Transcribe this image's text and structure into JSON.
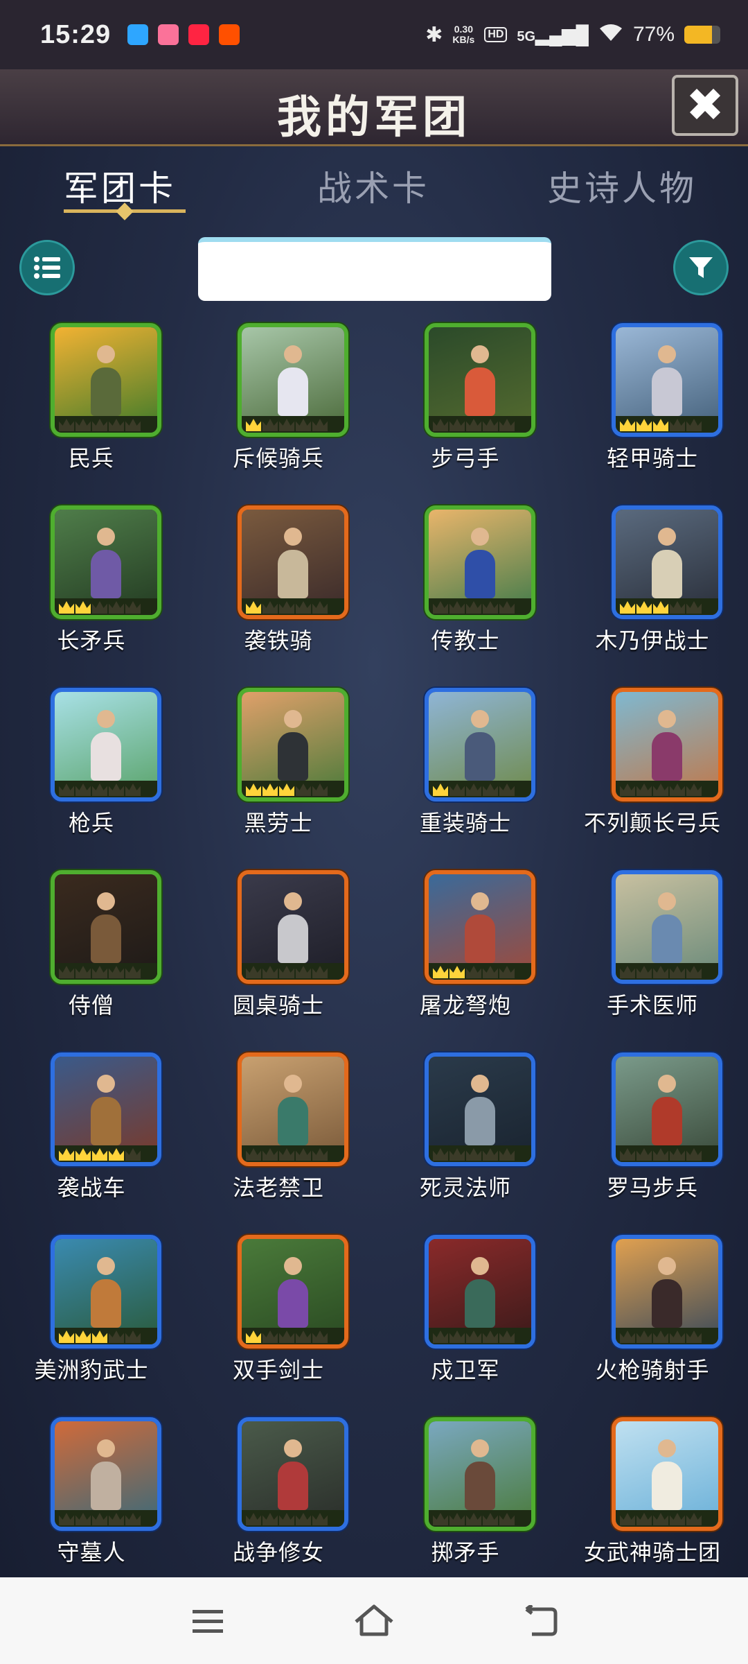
{
  "status_bar": {
    "time": "15:29",
    "net_speed": "0.30",
    "net_unit": "KB/s",
    "hd_badge": "HD",
    "signal_label": "5G",
    "battery_percent": "77%",
    "battery_level": 0.77,
    "notification_icons": [
      "telegram-icon",
      "bilibili-icon",
      "xiaohongshu-icon",
      "taobao-icon"
    ],
    "notification_colors": [
      "#2ea6ff",
      "#fb7299",
      "#ff2442",
      "#ff5000"
    ]
  },
  "header": {
    "title": "我的军团",
    "close_icon": "close-icon"
  },
  "tabs": [
    {
      "label": "军团卡",
      "active": true
    },
    {
      "label": "战术卡",
      "active": false
    },
    {
      "label": "史诗人物",
      "active": false
    }
  ],
  "toolbar": {
    "list_icon": "list-icon",
    "filter_icon": "filter-icon",
    "search_value": ""
  },
  "units": [
    {
      "name": "民兵",
      "rarity": "green",
      "stars": 0,
      "bg": [
        "#f2b233",
        "#3d7a2a"
      ],
      "tone": "#5a6a3a"
    },
    {
      "name": "斥候骑兵",
      "rarity": "green",
      "stars": 1,
      "bg": [
        "#a7c6a8",
        "#4b6a3a"
      ],
      "tone": "#e6e6f0"
    },
    {
      "name": "步弓手",
      "rarity": "green",
      "stars": 0,
      "bg": [
        "#2b4a2a",
        "#556b2f"
      ],
      "tone": "#d95a3a"
    },
    {
      "name": "轻甲骑士",
      "rarity": "blue",
      "stars": 3,
      "bg": [
        "#9ab7d6",
        "#44607a"
      ],
      "tone": "#c8c8d4"
    },
    {
      "name": "长矛兵",
      "rarity": "green",
      "stars": 2,
      "bg": [
        "#4f7d4a",
        "#233b22"
      ],
      "tone": "#6f5aa6"
    },
    {
      "name": "袭铁骑",
      "rarity": "orange",
      "stars": 1,
      "bg": [
        "#7a5a3e",
        "#3a2a2a"
      ],
      "tone": "#c8b89a"
    },
    {
      "name": "传教士",
      "rarity": "green",
      "stars": 0,
      "bg": [
        "#e9b56b",
        "#3f7a4a"
      ],
      "tone": "#2f4fa8"
    },
    {
      "name": "木乃伊战士",
      "rarity": "blue",
      "stars": 3,
      "bg": [
        "#5a6a7e",
        "#2a2f3a"
      ],
      "tone": "#d8cfb6"
    },
    {
      "name": "枪兵",
      "rarity": "blue",
      "stars": 0,
      "bg": [
        "#a8e0e6",
        "#5aa36a"
      ],
      "tone": "#e8e0e0"
    },
    {
      "name": "黑劳士",
      "rarity": "green",
      "stars": 3,
      "bg": [
        "#e0a06a",
        "#4a7a3a"
      ],
      "tone": "#2e3236"
    },
    {
      "name": "重装骑士",
      "rarity": "blue",
      "stars": 1,
      "bg": [
        "#8fb5d6",
        "#6f8a4a"
      ],
      "tone": "#4a5a7a"
    },
    {
      "name": "不列颠长弓兵",
      "rarity": "orange",
      "stars": 0,
      "bg": [
        "#7fb8d0",
        "#c0784a"
      ],
      "tone": "#8a3a6a"
    },
    {
      "name": "侍僧",
      "rarity": "green",
      "stars": 0,
      "bg": [
        "#3a2a1e",
        "#1e1a18"
      ],
      "tone": "#7a5a3a"
    },
    {
      "name": "圆桌骑士",
      "rarity": "orange",
      "stars": 0,
      "bg": [
        "#3a3a4a",
        "#1e1e28"
      ],
      "tone": "#c8c8cc"
    },
    {
      "name": "屠龙弩炮",
      "rarity": "orange",
      "stars": 2,
      "bg": [
        "#3a6a9a",
        "#a04a3a"
      ],
      "tone": "#b04a3a"
    },
    {
      "name": "手术医师",
      "rarity": "blue",
      "stars": 0,
      "bg": [
        "#c8c0a0",
        "#6a8a7a"
      ],
      "tone": "#6a8ab0"
    },
    {
      "name": "袭战车",
      "rarity": "blue",
      "stars": 4,
      "bg": [
        "#3a5a8a",
        "#7a3a2a"
      ],
      "tone": "#a0703a"
    },
    {
      "name": "法老禁卫",
      "rarity": "orange",
      "stars": 0,
      "bg": [
        "#c8a070",
        "#7a5a3a"
      ],
      "tone": "#3a7a6a"
    },
    {
      "name": "死灵法师",
      "rarity": "blue",
      "stars": 0,
      "bg": [
        "#2a3a4a",
        "#1a2430"
      ],
      "tone": "#8a9aa8"
    },
    {
      "name": "罗马步兵",
      "rarity": "blue",
      "stars": 0,
      "bg": [
        "#7a9a8a",
        "#3a4a3a"
      ],
      "tone": "#b03a2a"
    },
    {
      "name": "美洲豹武士",
      "rarity": "blue",
      "stars": 3,
      "bg": [
        "#3a8ab0",
        "#2a5a3a"
      ],
      "tone": "#c07a3a"
    },
    {
      "name": "双手剑士",
      "rarity": "orange",
      "stars": 1,
      "bg": [
        "#4a7a3a",
        "#2a4a22"
      ],
      "tone": "#7a4aa8"
    },
    {
      "name": "戍卫军",
      "rarity": "blue",
      "stars": 0,
      "bg": [
        "#8a2a2a",
        "#3a1a1a"
      ],
      "tone": "#3a6a5a"
    },
    {
      "name": "火枪骑射手",
      "rarity": "blue",
      "stars": 0,
      "bg": [
        "#e0a050",
        "#3a4a5a"
      ],
      "tone": "#3a2a2a"
    },
    {
      "name": "守墓人",
      "rarity": "blue",
      "stars": 0,
      "bg": [
        "#d06a3a",
        "#3a6a7a"
      ],
      "tone": "#c0b0a0"
    },
    {
      "name": "战争修女",
      "rarity": "blue",
      "stars": 0,
      "bg": [
        "#4a5a4a",
        "#2a2e2a"
      ],
      "tone": "#b03a3a"
    },
    {
      "name": "掷矛手",
      "rarity": "green",
      "stars": 0,
      "bg": [
        "#7aa8c0",
        "#4a7a3a"
      ],
      "tone": "#6a4a3a"
    },
    {
      "name": "女武神骑士团",
      "rarity": "orange",
      "stars": 0,
      "bg": [
        "#bfe0f0",
        "#6ab0d8"
      ],
      "tone": "#f0ece0"
    }
  ],
  "navbar": {
    "menu_icon": "menu-icon",
    "home_icon": "home-icon",
    "back_icon": "back-icon"
  }
}
